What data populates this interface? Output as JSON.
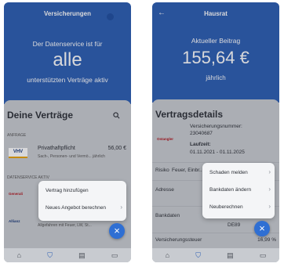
{
  "left": {
    "header_title": "Versicherungen",
    "hero_line1": "Der Datenservice ist für",
    "hero_big": "alle",
    "hero_line2": "unterstützten Verträge aktiv",
    "sheet_title": "Deine Verträge",
    "section_anfrage": "ANFRAGE",
    "contract": {
      "name": "Privathaftpflicht",
      "price": "56,00 €",
      "detail": "Sach-, Personen- und Vermö... jährlich",
      "logo_text": "VHV"
    },
    "section_datenservice": "DATENSERVICE AKTIV",
    "logo1": "Generali",
    "logo2": "Allianz",
    "bottom_text": "Allgefahren mit Feuer, LW, St...",
    "popup": [
      "Vertrag hinzufügen",
      "Neues Angebot berechnen"
    ]
  },
  "right": {
    "header_title": "Hausrat",
    "hero_label": "Aktueller Beitrag",
    "hero_amount": "155,64 €",
    "hero_period": "jährlich",
    "sheet_title": "Vertragsdetails",
    "versicherungsnummer_label": "Versicherungsnummer:",
    "versicherungsnummer_value": "23040687",
    "laufzeit_label": "Laufzeit:",
    "laufzeit_value": "01.11.2021 - 01.11.2025",
    "logo_text": "Ostangler",
    "risiko_label": "Risiko",
    "risiko_value": "Feuer, Einbr...",
    "adresse_label": "Adresse",
    "bankdaten_label": "Bankdaten",
    "iban_partial": "DE89",
    "steuer_label": "Versicherungssteuer",
    "steuer_value": "16,99 %",
    "popup": [
      "Schaden melden",
      "Bankdaten ändern",
      "Neuberechnen"
    ]
  },
  "nav_icons": [
    "home-icon",
    "shield-icon",
    "document-icon",
    "chat-icon"
  ],
  "colors": {
    "hero_blue": "#2a5db3",
    "fab_blue": "#2f6fd3"
  }
}
